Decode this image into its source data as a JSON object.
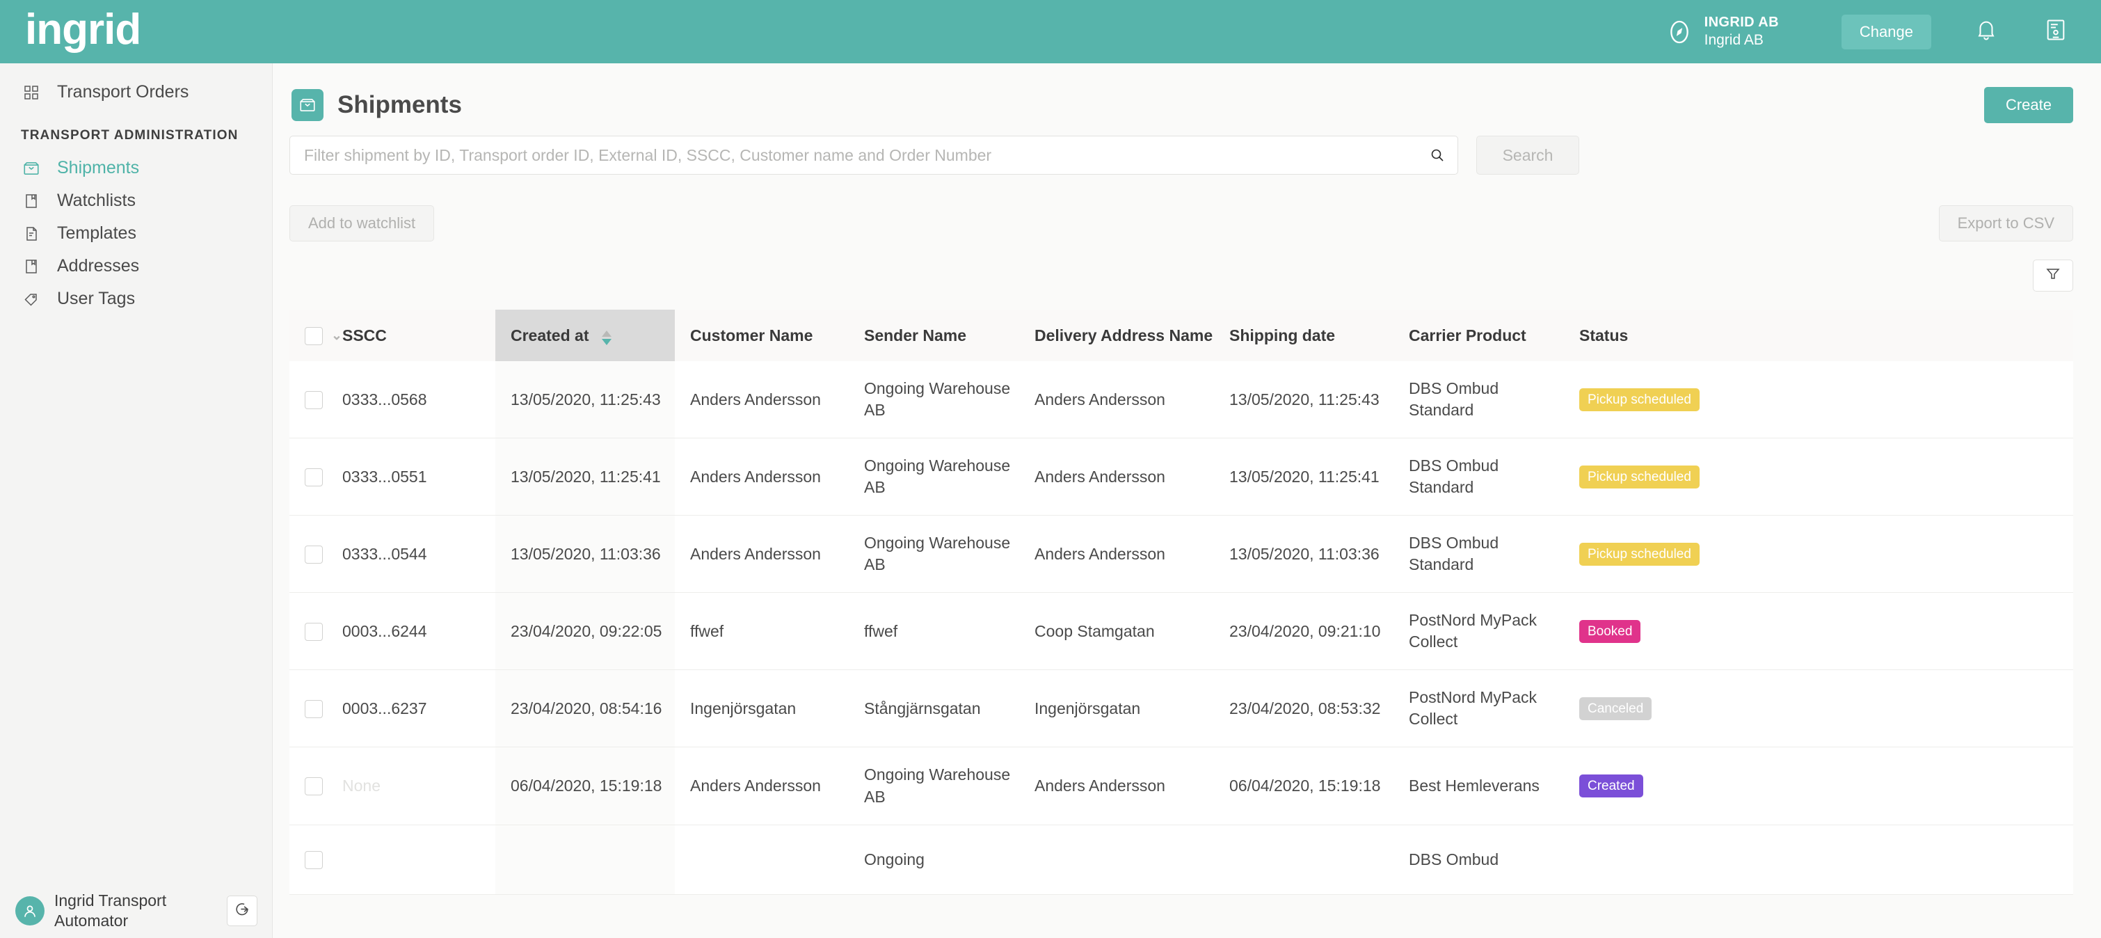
{
  "topbar": {
    "logo_text": "ingrid",
    "org_name_upper": "INGRID AB",
    "org_name": "Ingrid AB",
    "change_label": "Change",
    "compass_icon": "compass-icon",
    "bell_icon": "bell-icon",
    "contact_card_icon": "contact-card-icon",
    "brand_color": "#57b4ab",
    "change_button_color": "#6cc3bb"
  },
  "sidebar": {
    "top_items": [
      {
        "label": "Transport Orders",
        "icon": "grid-icon",
        "active": false
      }
    ],
    "section_label": "TRANSPORT ADMINISTRATION",
    "items": [
      {
        "label": "Shipments",
        "icon": "inbox-icon",
        "active": true
      },
      {
        "label": "Watchlists",
        "icon": "bookmark-page-icon",
        "active": false
      },
      {
        "label": "Templates",
        "icon": "document-lines-icon",
        "active": false
      },
      {
        "label": "Addresses",
        "icon": "bookmark-page-icon",
        "active": false
      },
      {
        "label": "User Tags",
        "icon": "tag-icon",
        "active": false
      }
    ],
    "footer": {
      "user_name": "Ingrid Transport Automator",
      "avatar_icon": "user-avatar-icon",
      "logout_icon": "logout-icon"
    },
    "active_color": "#4fb3a8"
  },
  "page": {
    "title": "Shipments",
    "title_icon": "inbox-icon",
    "create_label": "Create"
  },
  "search": {
    "placeholder": "Filter shipment by ID, Transport order ID, External ID, SSCC, Customer name and Order Number",
    "value": "",
    "search_icon": "search-icon",
    "button_label": "Search"
  },
  "actions": {
    "add_to_watchlist_label": "Add to watchlist",
    "export_csv_label": "Export to CSV",
    "filter_icon": "filter-funnel-icon"
  },
  "table": {
    "columns": [
      {
        "key": "check",
        "label": ""
      },
      {
        "key": "sscc",
        "label": "SSCC"
      },
      {
        "key": "created",
        "label": "Created at",
        "sorted": true,
        "sort_direction": "desc"
      },
      {
        "key": "customer",
        "label": "Customer Name"
      },
      {
        "key": "sender",
        "label": "Sender Name"
      },
      {
        "key": "delivery",
        "label": "Delivery Address Name"
      },
      {
        "key": "shipdate",
        "label": "Shipping date"
      },
      {
        "key": "carrier",
        "label": "Carrier Product"
      },
      {
        "key": "status",
        "label": "Status"
      }
    ],
    "rows": [
      {
        "sscc": "0333...0568",
        "sscc_muted": false,
        "created": "13/05/2020, 11:25:43",
        "customer": "Anders Andersson",
        "sender": "Ongoing Warehouse AB",
        "delivery": "Anders Andersson",
        "shipdate": "13/05/2020, 11:25:43",
        "carrier": "DBS Ombud Standard",
        "status": "Pickup scheduled",
        "status_color": "#f0d053"
      },
      {
        "sscc": "0333...0551",
        "sscc_muted": false,
        "created": "13/05/2020, 11:25:41",
        "customer": "Anders Andersson",
        "sender": "Ongoing Warehouse AB",
        "delivery": "Anders Andersson",
        "shipdate": "13/05/2020, 11:25:41",
        "carrier": "DBS Ombud Standard",
        "status": "Pickup scheduled",
        "status_color": "#f0d053"
      },
      {
        "sscc": "0333...0544",
        "sscc_muted": false,
        "created": "13/05/2020, 11:03:36",
        "customer": "Anders Andersson",
        "sender": "Ongoing Warehouse AB",
        "delivery": "Anders Andersson",
        "shipdate": "13/05/2020, 11:03:36",
        "carrier": "DBS Ombud Standard",
        "status": "Pickup scheduled",
        "status_color": "#f0d053"
      },
      {
        "sscc": "0003...6244",
        "sscc_muted": false,
        "created": "23/04/2020, 09:22:05",
        "customer": "ffwef",
        "sender": "ffwef",
        "delivery": "Coop Stamgatan",
        "shipdate": "23/04/2020, 09:21:10",
        "carrier": "PostNord MyPack Collect",
        "status": "Booked",
        "status_color": "#e0338b"
      },
      {
        "sscc": "0003...6237",
        "sscc_muted": false,
        "created": "23/04/2020, 08:54:16",
        "customer": "Ingenjörsgatan",
        "sender": "Stångjärnsgatan",
        "delivery": "Ingenjörsgatan",
        "shipdate": "23/04/2020, 08:53:32",
        "carrier": "PostNord MyPack Collect",
        "status": "Canceled",
        "status_color": "#d2d2d2"
      },
      {
        "sscc": "None",
        "sscc_muted": true,
        "created": "06/04/2020, 15:19:18",
        "customer": "Anders Andersson",
        "sender": "Ongoing Warehouse AB",
        "delivery": "Anders Andersson",
        "shipdate": "06/04/2020, 15:19:18",
        "carrier": "Best Hemleverans",
        "status": "Created",
        "status_color": "#7b4fd8"
      },
      {
        "sscc": "",
        "sscc_muted": false,
        "created": "",
        "customer": "",
        "sender": "Ongoing",
        "delivery": "",
        "shipdate": "",
        "carrier": "DBS Ombud",
        "status": "",
        "status_color": "#ffffff"
      }
    ]
  }
}
